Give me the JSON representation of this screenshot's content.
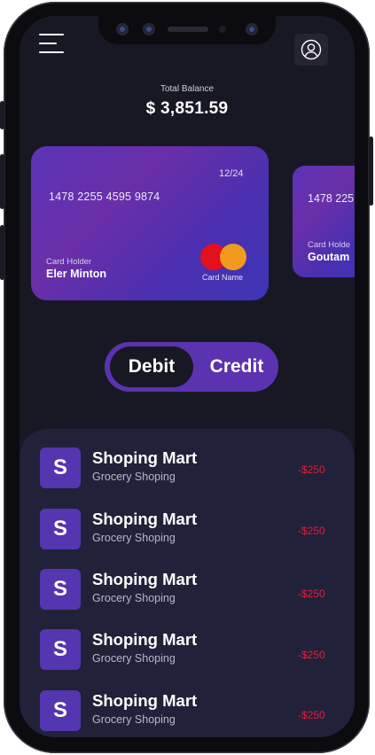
{
  "header": {
    "menu_icon": "hamburger-menu-icon",
    "profile_icon": "user-profile-icon"
  },
  "balance": {
    "label": "Total Balance",
    "amount": "$ 3,851.59"
  },
  "cards": [
    {
      "expiry": "12/24",
      "number": "1478 2255 4595 9874",
      "holder_label": "Card Holder",
      "holder_name": "Eler Minton",
      "brand_label": "Card Name",
      "brand_icon": "mastercard-logo-icon"
    },
    {
      "number": "1478 225",
      "holder_label": "Card Holde",
      "holder_name": "Goutam"
    }
  ],
  "toggle": {
    "debit_label": "Debit",
    "credit_label": "Credit",
    "selected": "Debit"
  },
  "transactions": [
    {
      "initial": "S",
      "title": "Shoping Mart",
      "subtitle": "Grocery Shoping",
      "amount": "-$250"
    },
    {
      "initial": "S",
      "title": "Shoping Mart",
      "subtitle": "Grocery Shoping",
      "amount": "-$250"
    },
    {
      "initial": "S",
      "title": "Shoping Mart",
      "subtitle": "Grocery Shoping",
      "amount": "-$250"
    },
    {
      "initial": "S",
      "title": "Shoping Mart",
      "subtitle": "Grocery Shoping",
      "amount": "-$250"
    },
    {
      "initial": "S",
      "title": "Shoping Mart",
      "subtitle": "Grocery Shoping",
      "amount": "-$250"
    }
  ],
  "colors": {
    "background": "#181825",
    "accent": "#5b33b0",
    "negative_amount": "#e0203a",
    "panel": "#22213a"
  }
}
